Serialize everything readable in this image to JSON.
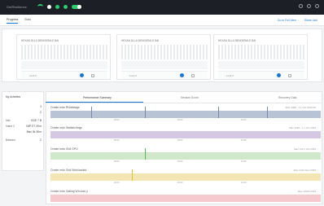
{
  "window": {
    "brand": "GetResilience"
  },
  "tabs": [
    "Progress",
    "Stats"
  ],
  "header_links": [
    "Go to Full View",
    "Share Link"
  ],
  "cards": [
    {
      "title": "HEXAN DLLU BENDERALE BAI",
      "label": "Lock 3"
    },
    {
      "title": "HEXAN DLLU BENDERALE BAI",
      "label": "Lock 3"
    },
    {
      "title": "HEXAN DLLU BENDERALE BAI",
      "label": "Lock 3"
    }
  ],
  "sidebar": {
    "title": "My Activities",
    "rows": [
      {
        "k": "",
        "v": "3"
      },
      {
        "k": "",
        "v": "2"
      },
      {
        "k": "Info",
        "v": "KDE 7 B"
      },
      {
        "k": "Value 2",
        "v": "IMP ET 2Km"
      },
      {
        "k": "",
        "v": "Max 3k 3Km"
      },
      {
        "k": "Balance",
        "v": "2"
      }
    ]
  },
  "chart_tabs": [
    "Performance Summary",
    "Session Score",
    "Recovery Data"
  ],
  "charts": [
    {
      "title": "Create redo RN/alstags",
      "meta": "Max 1084 - 1.1 Hrs 2023-05",
      "color": "#b9c3d6",
      "spikes": [
        0.15,
        0.35,
        0.8,
        0.62
      ]
    },
    {
      "title": "Create redo Statistic/Imgs",
      "meta": "Max 1016 - 1.1 Hrs 2023",
      "color": "#d4c8e2",
      "spikes": []
    },
    {
      "title": "Create redo Grid GPU",
      "meta": "Max 144 2 Hrs 2023",
      "color": "#cfe8c9",
      "spikes": [
        0.35
      ]
    },
    {
      "title": "Create redo Grid Workloaded",
      "meta": "Max 1016 Abel 2023",
      "color": "#f1e6b4",
      "spikes": [
        0.3
      ]
    },
    {
      "title": "Create redo Gatling Wh dom-y",
      "meta": "Max 10009 2023",
      "color": "#f6c9cf",
      "spikes": []
    }
  ],
  "axis_ticks": [
    "00:00",
    "06:00",
    "12:00"
  ],
  "colors": {
    "accent": "#1976d2",
    "green": "#2ecc71",
    "topbar": "#1c1f26"
  }
}
